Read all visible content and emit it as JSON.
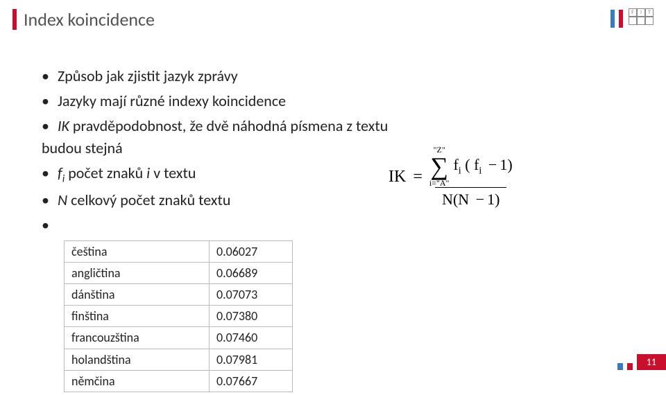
{
  "header": {
    "title": "Index koincidence",
    "logo_text": "FIT"
  },
  "bullets": {
    "b1": "Způsob jak zjistit jazyk zprávy",
    "b2": "Jazyky mají různé indexy koincidence",
    "b3_pre": "IK",
    "b3_rest": " pravděpodobnost, že dvě náhodná písmena z textu budou stejná",
    "b4_pre": "f",
    "b4_sub": "i",
    "b4_rest": " počet znaků ",
    "b4_ital": "i",
    "b4_tail": " v textu",
    "b5_pre": "N",
    "b5_rest": " celkový počet znaků textu"
  },
  "table": {
    "rows": [
      {
        "lang": "čeština",
        "val": "0.06027"
      },
      {
        "lang": "angličtina",
        "val": "0.06689"
      },
      {
        "lang": "dánština",
        "val": "0.07073"
      },
      {
        "lang": "finština",
        "val": "0.07380"
      },
      {
        "lang": "francouzština",
        "val": "0.07460"
      },
      {
        "lang": "holandština",
        "val": "0.07981"
      },
      {
        "lang": "němčina",
        "val": "0.07667"
      }
    ]
  },
  "formula": {
    "lhs": "IK",
    "eq": "=",
    "sum_top": "\"Z\"",
    "sum_bot": "i=\"A\"",
    "num_expr_a": "f",
    "num_expr_b": "( f",
    "num_expr_c": "1)",
    "minus": "−",
    "den_a": "N",
    "den_b": "(N",
    "den_c": "1)"
  },
  "footer": {
    "page": "11"
  }
}
